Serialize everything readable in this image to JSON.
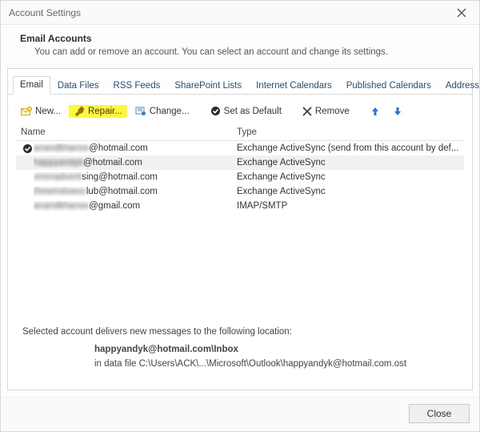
{
  "windowTitle": "Account Settings",
  "header": {
    "title": "Email Accounts",
    "subtitle": "You can add or remove an account. You can select an account and change its settings."
  },
  "tabs": [
    {
      "label": "Email",
      "active": true
    },
    {
      "label": "Data Files",
      "active": false
    },
    {
      "label": "RSS Feeds",
      "active": false
    },
    {
      "label": "SharePoint Lists",
      "active": false
    },
    {
      "label": "Internet Calendars",
      "active": false
    },
    {
      "label": "Published Calendars",
      "active": false
    },
    {
      "label": "Address Books",
      "active": false
    }
  ],
  "toolbar": {
    "new": "New...",
    "repair": "Repair...",
    "change": "Change...",
    "setDefault": "Set as Default",
    "remove": "Remove"
  },
  "columns": {
    "name": "Name",
    "type": "Type"
  },
  "accounts": [
    {
      "default": true,
      "selected": false,
      "blurPrefix": "anandkhanse",
      "visible": "@hotmail.com",
      "type": "Exchange ActiveSync (send from this account by def..."
    },
    {
      "default": false,
      "selected": true,
      "blurPrefix": "happyandyk",
      "visible": "@hotmail.com",
      "type": "Exchange ActiveSync"
    },
    {
      "default": false,
      "selected": false,
      "blurPrefix": "orionadverti",
      "visible": "sing@hotmail.com",
      "type": "Exchange ActiveSync"
    },
    {
      "default": false,
      "selected": false,
      "blurPrefix": "thewindowsc",
      "visible": "lub@hotmail.com",
      "type": "Exchange ActiveSync"
    },
    {
      "default": false,
      "selected": false,
      "blurPrefix": "anandkhanse",
      "visible": "@gmail.com",
      "type": "IMAP/SMTP"
    }
  ],
  "delivery": {
    "label": "Selected account delivers new messages to the following location:",
    "mailbox": "happyandyk@hotmail.com\\Inbox",
    "datafile": "in data file C:\\Users\\ACK\\...\\Microsoft\\Outlook\\happyandyk@hotmail.com.ost"
  },
  "closeLabel": "Close"
}
